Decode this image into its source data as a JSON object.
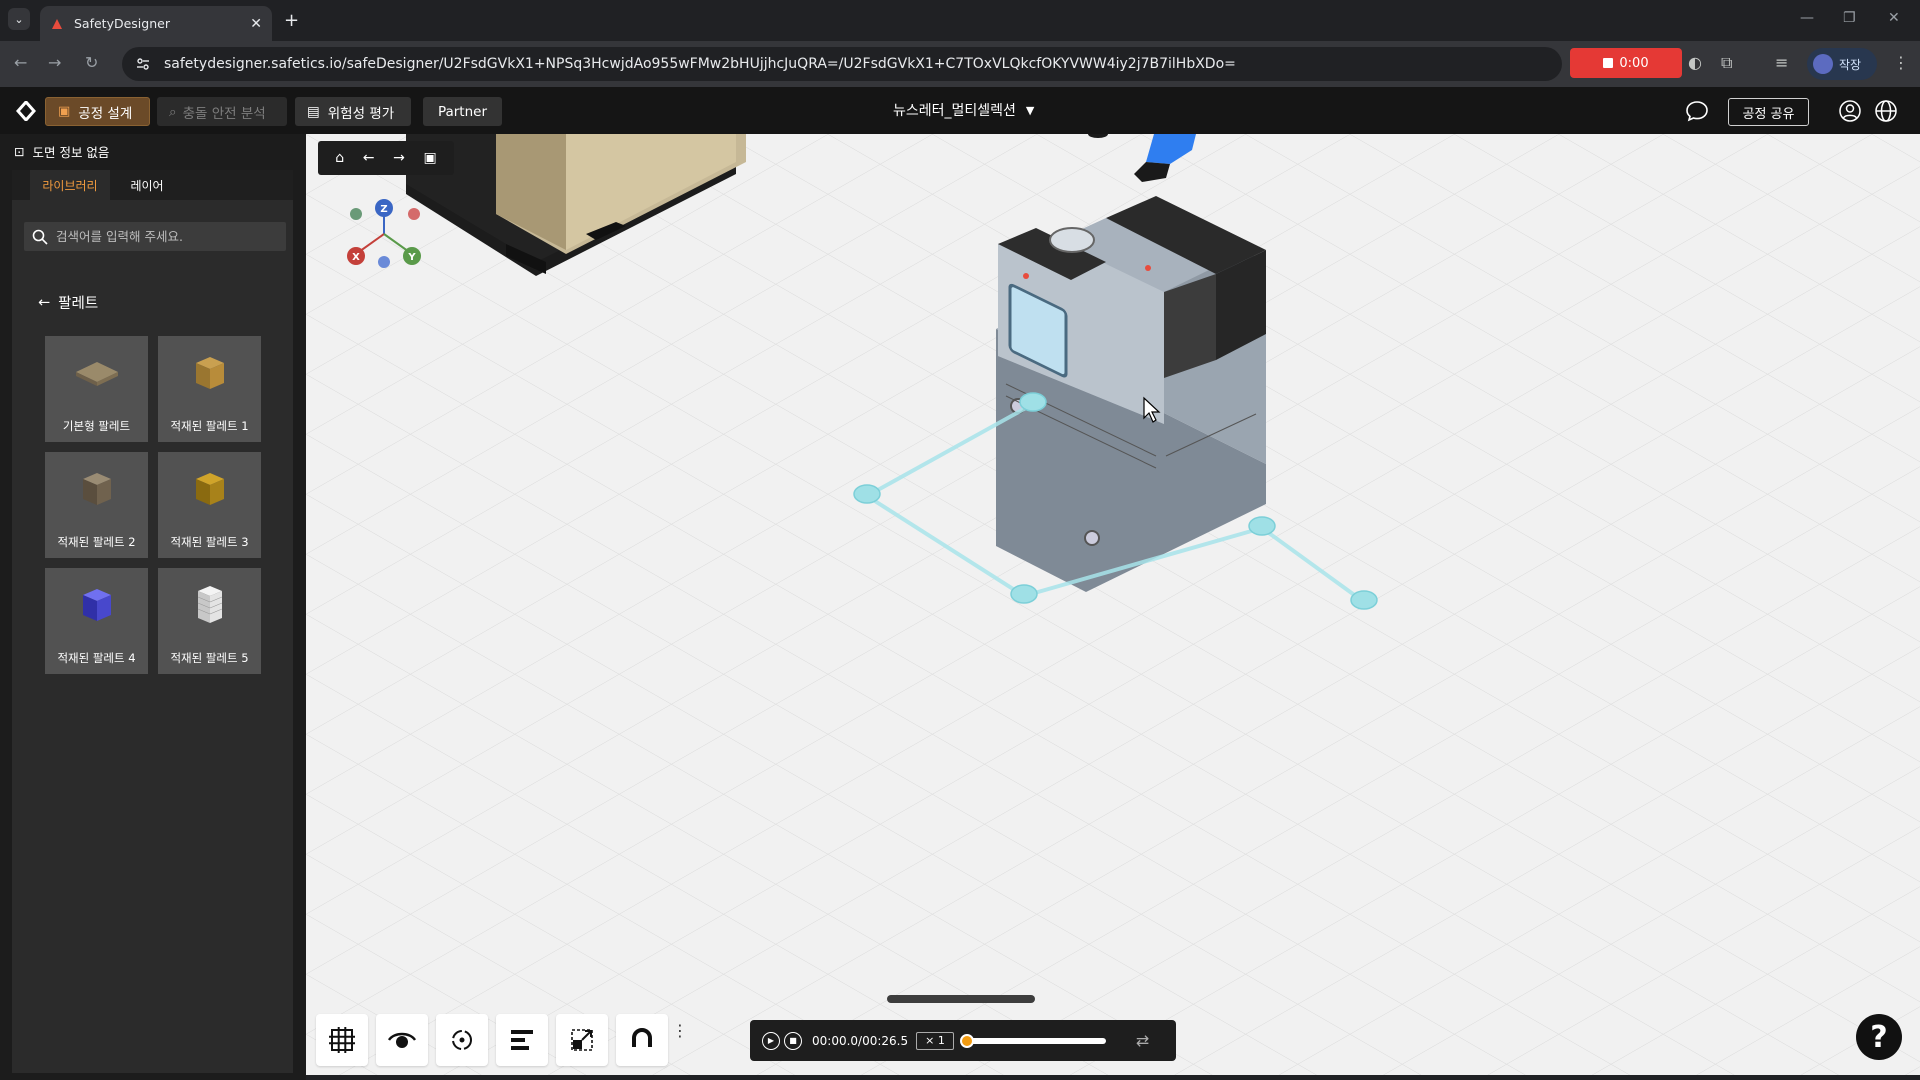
{
  "browser": {
    "tab_title": "SafetyDesigner",
    "url": "safetydesigner.safetics.io/safeDesigner/U2FsdGVkX1+NPSq3HcwjdAo955wFMw2bHUjjhcJuQRA=/U2FsdGVkX1+C7TOxVLQkcfOKYVWW4iy2j7B7ilHbXDo=",
    "recording_time": "0:00",
    "profile_label": "작장",
    "icons": [
      "tab-dropdown-icon",
      "close-icon",
      "new-tab-icon",
      "back-icon",
      "forward-icon",
      "reload-icon",
      "site-info-icon",
      "extensions-icon",
      "media-icon",
      "menu-icon"
    ]
  },
  "appbar": {
    "process_design": "공정 설계",
    "collision_safety": "충돌 안전 분석",
    "risk_assessment": "위험성 평가",
    "partner": "Partner",
    "project_name": "뉴스레터_멀티셀렉션",
    "share": "공정 공유"
  },
  "sidebar": {
    "drawing_info": "도면 정보 없음",
    "tab_library": "라이브러리",
    "tab_layer": "레이어",
    "search_placeholder": "검색어를 입력해 주세요.",
    "category": "팔레트",
    "items": [
      {
        "label": "기본형 팔레트",
        "color": "#8a7a60"
      },
      {
        "label": "적재된 팔레트 1",
        "color": "#b0883a"
      },
      {
        "label": "적재된 팔레트 2",
        "color": "#6e6250"
      },
      {
        "label": "적재된 팔레트 3",
        "color": "#b08a1c"
      },
      {
        "label": "적재된 팔레트 4",
        "color": "#4a4ad0"
      },
      {
        "label": "적재된 팔레트 5",
        "color": "#e0e0e0"
      }
    ]
  },
  "viewport": {
    "axes": {
      "z": "Z",
      "x": "X",
      "y": "Y"
    },
    "player": {
      "time": "00:00.0/00:26.5",
      "speed": "× 1",
      "progress": 0
    }
  },
  "colors": {
    "accent": "#f09a3e",
    "path": "#9fe0e6",
    "record": "#e53935"
  }
}
